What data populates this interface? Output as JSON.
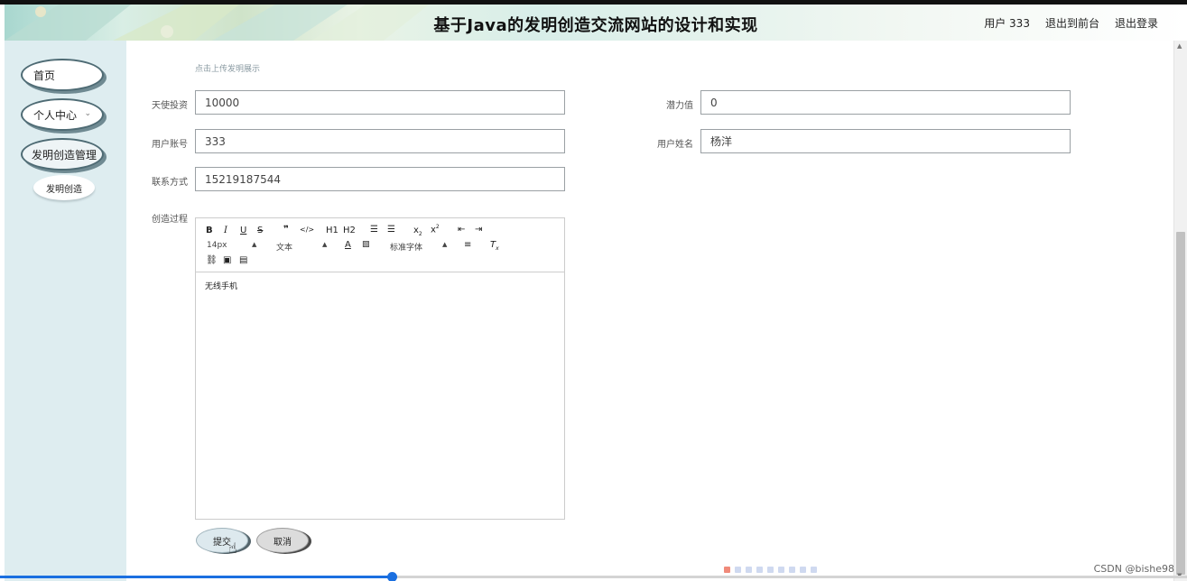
{
  "header": {
    "title": "基于Java的发明创造交流网站的设计和实现",
    "user_label": "用户 333",
    "front_link": "退出到前台",
    "logout_link": "退出登录"
  },
  "sidebar": {
    "items": [
      {
        "label": "首页"
      },
      {
        "label": "个人中心"
      },
      {
        "label": "发明创造管理"
      }
    ],
    "sub_item": "发明创造"
  },
  "form": {
    "upload_hint": "点击上传发明展示",
    "angel_investment": {
      "label": "天使投资",
      "value": "10000"
    },
    "potential": {
      "label": "潜力值",
      "value": "0"
    },
    "user_account": {
      "label": "用户账号",
      "value": "333"
    },
    "user_name": {
      "label": "用户姓名",
      "value": "杨洋"
    },
    "contact": {
      "label": "联系方式",
      "value": "15219187544"
    },
    "process": {
      "label": "创造过程"
    }
  },
  "editor": {
    "font_size": "14px",
    "text_type": "文本",
    "font_family": "标准字体",
    "h1": "H1",
    "h2": "H2",
    "content": "无线手机"
  },
  "buttons": {
    "submit": "提交",
    "cancel": "取消"
  },
  "progress": {
    "fraction": 0.33
  },
  "watermark": "CSDN @bishe98",
  "colors": {
    "sidebar_bg": "#deedf0",
    "pill_border": "#4e6b74",
    "progress": "#1a6fe0"
  }
}
